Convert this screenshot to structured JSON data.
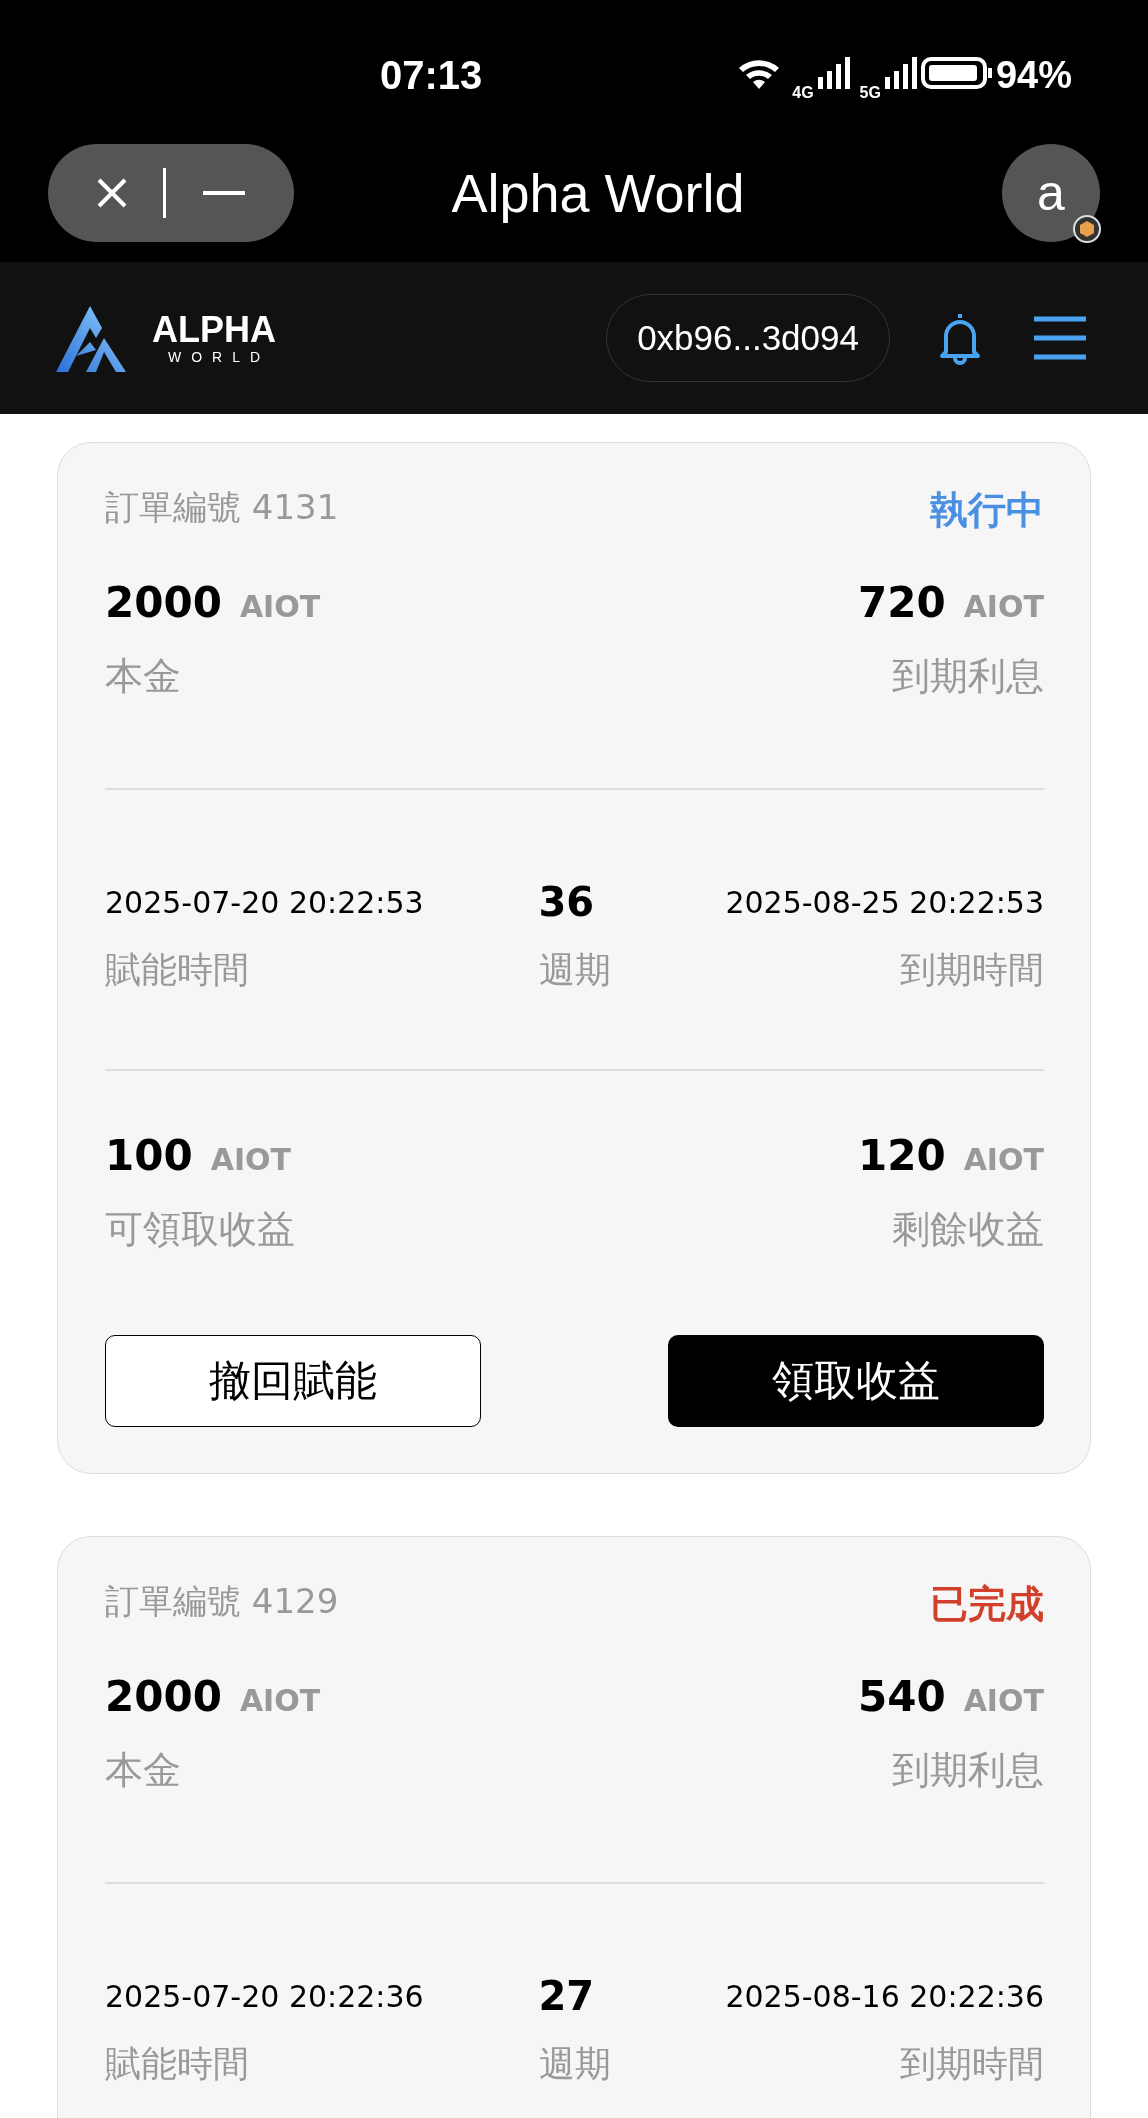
{
  "status_bar": {
    "time": "07:13",
    "networks": [
      "4G",
      "5G"
    ],
    "battery": "94%"
  },
  "logo": {
    "name": "ALPHA",
    "sub": "WORLD"
  },
  "window": {
    "title": "Alpha World",
    "avatar": "a"
  },
  "nav": {
    "wallet": "0xb96...3d094"
  },
  "orders": [
    {
      "order_label": "訂單編號 4131",
      "status": {
        "text": "執行中",
        "kind": "running"
      },
      "principal": {
        "amount": "2000",
        "unit": "AIOT",
        "label": "本金"
      },
      "interest": {
        "amount": "720",
        "unit": "AIOT",
        "label": "到期利息"
      },
      "start": {
        "value": "2025-07-20 20:22:53",
        "label": "賦能時間"
      },
      "period": {
        "value": "36",
        "label": "週期"
      },
      "end": {
        "value": "2025-08-25 20:22:53",
        "label": "到期時間"
      },
      "claimable": {
        "amount": "100",
        "unit": "AIOT",
        "label": "可領取收益"
      },
      "remaining": {
        "amount": "120",
        "unit": "AIOT",
        "label": "剩餘收益"
      },
      "buttons": [
        {
          "label": "撤回賦能",
          "kind": "outline"
        },
        {
          "label": "領取收益",
          "kind": "filled"
        }
      ]
    },
    {
      "order_label": "訂單編號 4129",
      "status": {
        "text": "已完成",
        "kind": "done"
      },
      "principal": {
        "amount": "2000",
        "unit": "AIOT",
        "label": "本金"
      },
      "interest": {
        "amount": "540",
        "unit": "AIOT",
        "label": "到期利息"
      },
      "start": {
        "value": "2025-07-20 20:22:36",
        "label": "賦能時間"
      },
      "period": {
        "value": "27",
        "label": "週期"
      },
      "end": {
        "value": "2025-08-16 20:22:36",
        "label": "到期時間"
      }
    }
  ]
}
